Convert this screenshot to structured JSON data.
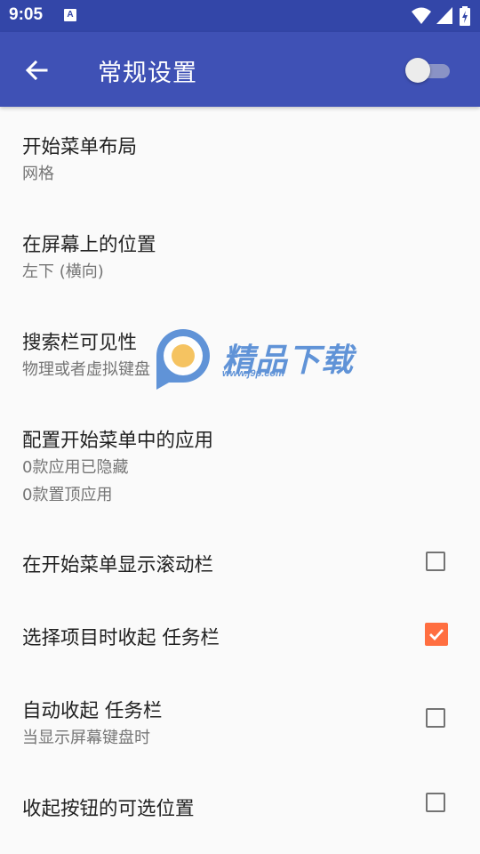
{
  "status_bar": {
    "time": "9:05",
    "notification_icon_letter": "A",
    "icons": [
      "wifi-icon",
      "signal-icon",
      "battery-icon"
    ]
  },
  "app_bar": {
    "title": "常规设置",
    "back_icon": "arrow-left-icon",
    "master_switch_on": false
  },
  "settings": {
    "start_menu_layout": {
      "title": "开始菜单布局",
      "summary": "网格"
    },
    "position_on_screen": {
      "title": "在屏幕上的位置",
      "summary": "左下 (横向)"
    },
    "search_bar_visibility": {
      "title": "搜索栏可见性",
      "summary": "物理或者虚拟键盘"
    },
    "configure_apps": {
      "title": "配置开始菜单中的应用",
      "summary_1": "0款应用已隐藏",
      "summary_2": "0款置顶应用"
    },
    "show_scrollbar": {
      "title": "在开始菜单显示滚动栏",
      "checked": false
    },
    "collapse_on_select": {
      "title": "选择项目时收起 任务栏",
      "checked": true
    },
    "auto_collapse": {
      "title": "自动收起 任务栏",
      "summary": "当显示屏幕键盘时",
      "checked": false
    },
    "collapse_button_position": {
      "title": "收起按钮的可选位置",
      "checked": false
    }
  },
  "watermark": {
    "text": "精品下载",
    "url": "www.j9p.com"
  },
  "colors": {
    "status_bar": "#3346a8",
    "app_bar": "#3f51b5",
    "accent": "#ff6e40",
    "background": "#fafafa"
  }
}
